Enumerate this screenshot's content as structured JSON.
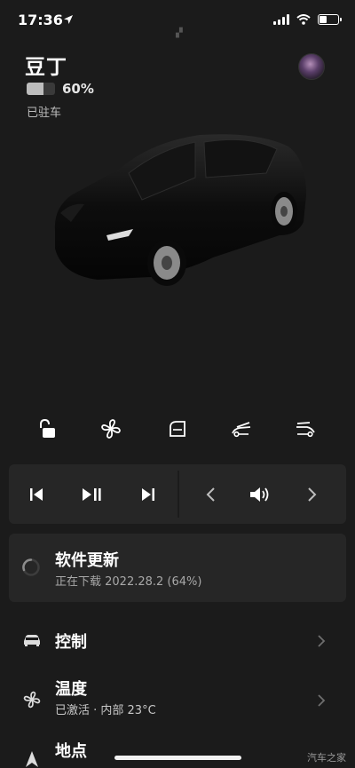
{
  "status_bar": {
    "time": "17:36"
  },
  "header": {
    "car_name": "豆丁",
    "battery_percent": "60%",
    "battery_level": 0.6,
    "state": "已驻车"
  },
  "quick_actions": [
    {
      "icon": "unlock-icon"
    },
    {
      "icon": "fan-icon"
    },
    {
      "icon": "frunk-window-icon"
    },
    {
      "icon": "frunk-open-icon"
    },
    {
      "icon": "trunk-open-icon"
    }
  ],
  "media": {
    "controls": [
      "previous-track-icon",
      "play-pause-icon",
      "next-track-icon",
      "volume-down-chevron-icon",
      "speaker-icon",
      "volume-up-chevron-icon"
    ]
  },
  "software_update": {
    "title": "软件更新",
    "subtitle": "正在下载 2022.28.2 (64%)",
    "progress": 0.64
  },
  "menu": [
    {
      "title": "控制",
      "subtitle": "",
      "icon": "car-icon"
    },
    {
      "title": "温度",
      "subtitle": "已激活 · 内部 23°C",
      "icon": "fan-icon"
    },
    {
      "title": "地点",
      "subtitle": "",
      "icon": "navigation-icon"
    }
  ],
  "watermark": "汽车之家",
  "colors": {
    "background": "#1b1b1b",
    "card": "#262626",
    "text": "#ffffff",
    "secondary_text": "#a8a8a8"
  }
}
